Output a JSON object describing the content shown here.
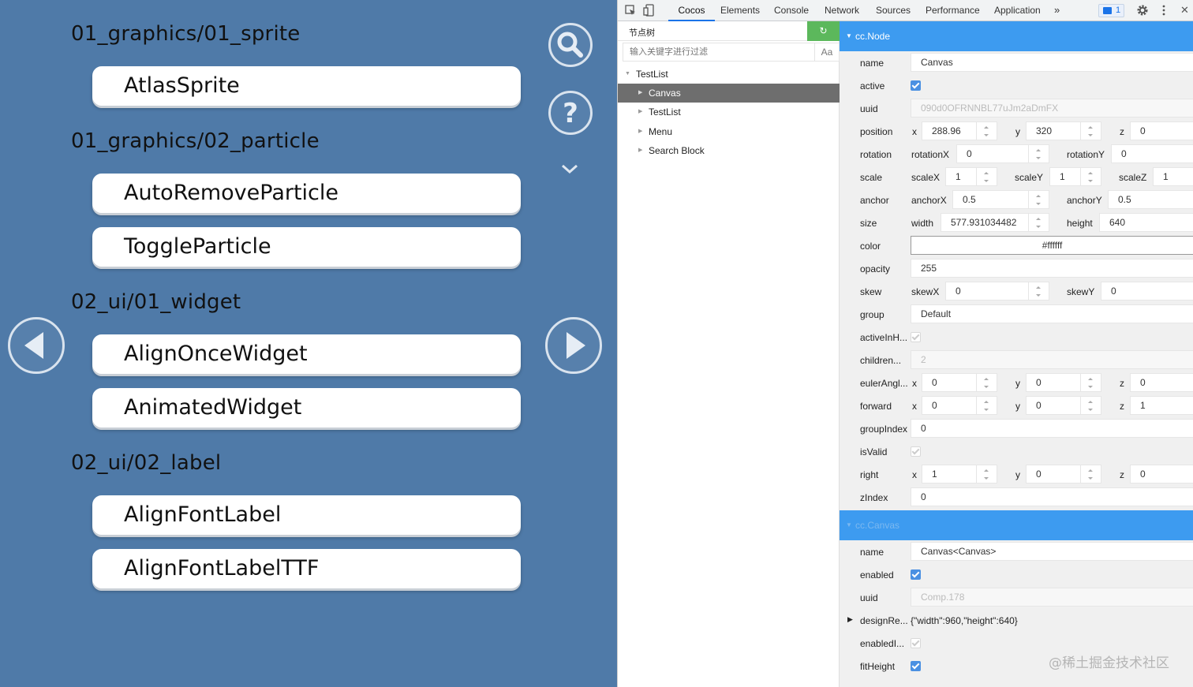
{
  "game": {
    "sections": [
      "01_graphics/01_sprite",
      "01_graphics/02_particle",
      "02_ui/01_widget",
      "02_ui/02_label"
    ],
    "buttons": [
      "AtlasSprite",
      "AutoRemoveParticle",
      "ToggleParticle",
      "AlignOnceWidget",
      "AnimatedWidget",
      "AlignFontLabel",
      "AlignFontLabelTTF"
    ],
    "icons": [
      "search-icon",
      "help-icon",
      "chevron-down-icon",
      "arrow-left-icon",
      "arrow-right-icon"
    ]
  },
  "devtools": {
    "tabs": [
      "Cocos",
      "Elements",
      "Console",
      "Network",
      "Sources",
      "Performance",
      "Application"
    ],
    "active_tab": "Cocos",
    "more": "»",
    "issues_count": "1",
    "close": "✕",
    "accent": "#1a73e8"
  },
  "tree": {
    "title": "节点树",
    "refresh": "↻",
    "filter_placeholder": "输入关键字进行过滤",
    "case_toggle": "Aa",
    "nodes": [
      {
        "label": "TestList",
        "selected": false
      },
      {
        "label": "Canvas",
        "selected": true
      },
      {
        "label": "TestList",
        "selected": false
      },
      {
        "label": "Menu",
        "selected": false
      },
      {
        "label": "Search Block",
        "selected": false
      }
    ]
  },
  "inspector": {
    "header_color": "#3d9bf0",
    "node": {
      "title": "cc.Node",
      "name_label": "name",
      "name": "Canvas",
      "active_label": "active",
      "uuid_label": "uuid",
      "uuid": "090d0OFRNNBL77uJm2aDmFX",
      "position_label": "position",
      "pos_x_label": "x",
      "pos_x": "288.96",
      "pos_y_label": "y",
      "pos_y": "320",
      "pos_z_label": "z",
      "pos_z": "0",
      "rotation_label": "rotation",
      "rot_x_label": "rotationX",
      "rot_x": "0",
      "rot_y_label": "rotationY",
      "rot_y": "0",
      "scale_label": "scale",
      "scale_x_label": "scaleX",
      "scale_x": "1",
      "scale_y_label": "scaleY",
      "scale_y": "1",
      "scale_z_label": "scaleZ",
      "scale_z": "1",
      "anchor_label": "anchor",
      "anchor_x_label": "anchorX",
      "anchor_x": "0.5",
      "anchor_y_label": "anchorY",
      "anchor_y": "0.5",
      "size_label": "size",
      "width_label": "width",
      "width": "577.931034482",
      "height_label": "height",
      "height": "640",
      "color_label": "color",
      "color": "#ffffff",
      "opacity_label": "opacity",
      "opacity": "255",
      "skew_label": "skew",
      "skew_x_label": "skewX",
      "skew_x": "0",
      "skew_y_label": "skewY",
      "skew_y": "0",
      "group_label": "group",
      "group": "Default",
      "active_hier_label": "activeInH...",
      "children_label": "children...",
      "children": "2",
      "euler_label": "eulerAngl...",
      "euler_x_label": "x",
      "euler_x": "0",
      "euler_y_label": "y",
      "euler_y": "0",
      "euler_z_label": "z",
      "euler_z": "0",
      "forward_label": "forward",
      "fwd_x_label": "x",
      "fwd_x": "0",
      "fwd_y_label": "y",
      "fwd_y": "0",
      "fwd_z_label": "z",
      "fwd_z": "1",
      "group_index_label": "groupIndex",
      "group_index": "0",
      "is_valid_label": "isValid",
      "right_label": "right",
      "right_x_label": "x",
      "right_x": "1",
      "right_y_label": "y",
      "right_y": "0",
      "right_z_label": "z",
      "right_z": "0",
      "zindex_label": "zIndex",
      "zindex": "0"
    },
    "canvas": {
      "title": "cc.Canvas",
      "name_label": "name",
      "name": "Canvas<Canvas>",
      "enabled_label": "enabled",
      "uuid_label": "uuid",
      "uuid": "Comp.178",
      "design_label": "designRe...",
      "design": "{\"width\":960,\"height\":640}",
      "enabled_hier_label": "enabledI...",
      "fit_height_label": "fitHeight"
    }
  },
  "watermark": "@稀土掘金技术社区"
}
